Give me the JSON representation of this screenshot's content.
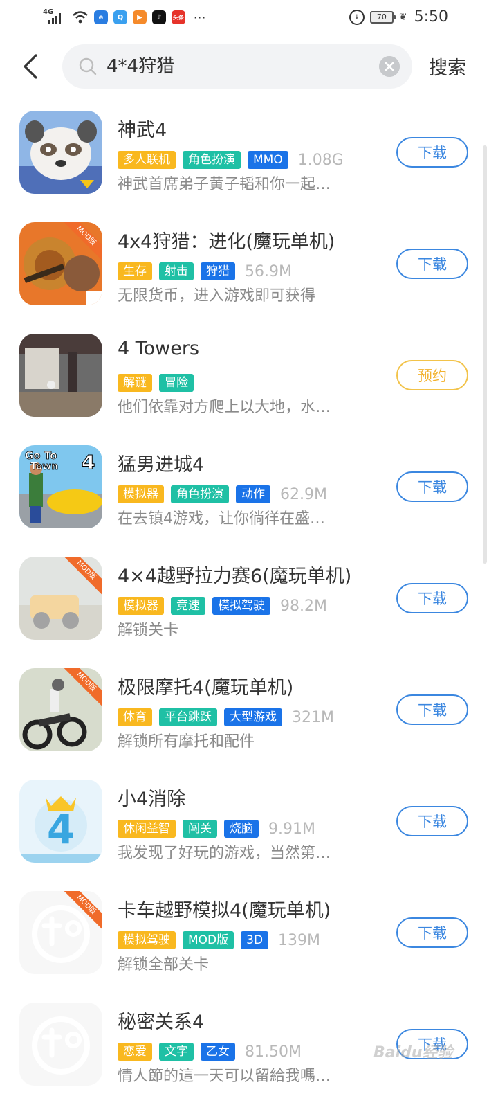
{
  "status_bar": {
    "network": "4G",
    "mini_apps": [
      {
        "name": "browser-app-icon",
        "color": "#2a7de1",
        "glyph": "e"
      },
      {
        "name": "qq-browser-app-icon",
        "color": "#3aa0ef",
        "glyph": "Q"
      },
      {
        "name": "video-app-icon",
        "color": "#f58a2a",
        "glyph": "▶"
      },
      {
        "name": "tiktok-app-icon",
        "color": "#111111",
        "glyph": "♪"
      },
      {
        "name": "toutiao-app-icon",
        "color": "#e6332a",
        "glyph": "头条"
      }
    ],
    "more": "···",
    "battery": "70",
    "time": "5:50"
  },
  "search": {
    "query": "4*4狩猎",
    "submit_label": "搜索"
  },
  "results": [
    {
      "title": "神武4",
      "tags": [
        {
          "text": "多人联机",
          "color": "#f9b81f"
        },
        {
          "text": "角色扮演",
          "color": "#1fc0a5"
        },
        {
          "text": "MMO",
          "color": "#1a73e8"
        }
      ],
      "size": "1.08G",
      "desc": "神武首席弟子黄子韬和你一起…",
      "action": "下载",
      "icon": "panda"
    },
    {
      "title": "4x4狩猎：进化(魔玩单机)",
      "tags": [
        {
          "text": "生存",
          "color": "#f9b81f"
        },
        {
          "text": "射击",
          "color": "#1fc0a5"
        },
        {
          "text": "狩猎",
          "color": "#1a73e8"
        }
      ],
      "size": "56.9M",
      "desc": "无限货币，进入游戏即可获得",
      "action": "下载",
      "icon": "lion",
      "mod": "MOD版"
    },
    {
      "title": "4 Towers",
      "tags": [
        {
          "text": "解谜",
          "color": "#f9b81f"
        },
        {
          "text": "冒险",
          "color": "#1fc0a5"
        }
      ],
      "size": "",
      "desc": "他们依靠对方爬上以大地，水…",
      "action": "预约",
      "icon": "towers"
    },
    {
      "title": "猛男进城4",
      "tags": [
        {
          "text": "模拟器",
          "color": "#f9b81f"
        },
        {
          "text": "角色扮演",
          "color": "#1fc0a5"
        },
        {
          "text": "动作",
          "color": "#1a73e8"
        }
      ],
      "size": "62.9M",
      "desc": "在去镇4游戏，让你徜徉在盛…",
      "action": "下载",
      "icon": "gototown",
      "icon_text": "Go To Town"
    },
    {
      "title": "4×4越野拉力赛6(魔玩单机)",
      "tags": [
        {
          "text": "模拟器",
          "color": "#f9b81f"
        },
        {
          "text": "竞速",
          "color": "#1fc0a5"
        },
        {
          "text": "模拟驾驶",
          "color": "#1a73e8"
        }
      ],
      "size": "98.2M",
      "desc": "解锁关卡",
      "action": "下载",
      "icon": "offroad",
      "mod": "MOD版"
    },
    {
      "title": "极限摩托4(魔玩单机)",
      "tags": [
        {
          "text": "体育",
          "color": "#f9b81f"
        },
        {
          "text": "平台跳跃",
          "color": "#1fc0a5"
        },
        {
          "text": "大型游戏",
          "color": "#1a73e8"
        }
      ],
      "size": "321M",
      "desc": "解锁所有摩托和配件",
      "action": "下载",
      "icon": "moto",
      "mod": "MOD版"
    },
    {
      "title": "小4消除",
      "tags": [
        {
          "text": "休闲益智",
          "color": "#f9b81f"
        },
        {
          "text": "闯关",
          "color": "#1fc0a5"
        },
        {
          "text": "烧脑",
          "color": "#1a73e8"
        }
      ],
      "size": "9.91M",
      "desc": "我发现了好玩的游戏，当然第…",
      "action": "下载",
      "icon": "four"
    },
    {
      "title": "卡车越野模拟4(魔玩单机)",
      "tags": [
        {
          "text": "模拟驾驶",
          "color": "#f9b81f"
        },
        {
          "text": "MOD版",
          "color": "#1fc0a5"
        },
        {
          "text": "3D",
          "color": "#1a73e8"
        }
      ],
      "size": "139M",
      "desc": "解锁全部关卡",
      "action": "下载",
      "icon": "placeholder",
      "mod": "MOD版"
    },
    {
      "title": "秘密关系4",
      "tags": [
        {
          "text": "恋爱",
          "color": "#f9b81f"
        },
        {
          "text": "文字",
          "color": "#1fc0a5"
        },
        {
          "text": "乙女",
          "color": "#1a73e8"
        }
      ],
      "size": "81.50M",
      "desc": "情人節的這一天可以留給我嗎…",
      "action": "下载",
      "icon": "placeholder"
    }
  ],
  "watermark": "Baidu经验"
}
